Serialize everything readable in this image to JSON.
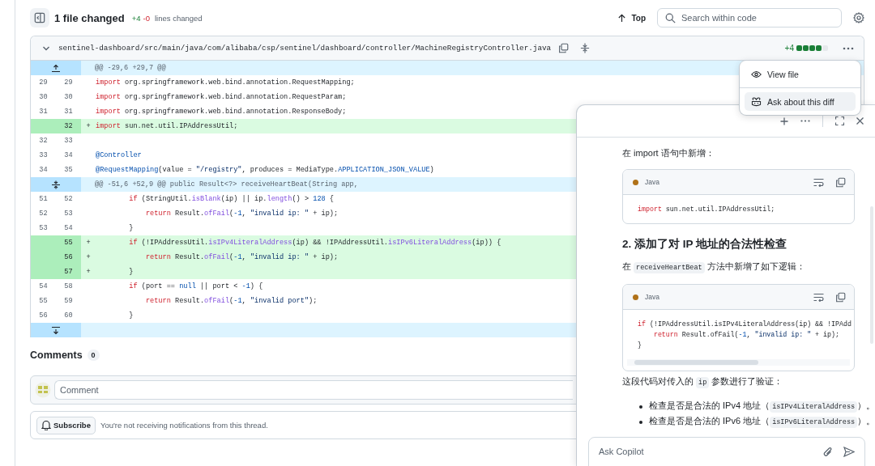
{
  "header": {
    "title": "1 file changed",
    "added": "+4",
    "removed": "-0",
    "note": "lines changed",
    "top_button": "Top",
    "search": {
      "placeholder": "Search within code"
    }
  },
  "file": {
    "path": "sentinel-dashboard/src/main/java/com/alibaba/csp/sentinel/dashboard/controller/MachineRegistryController.java",
    "expanded": true,
    "added": "+4",
    "level": 0.8
  },
  "diff": [
    {
      "kind": "hunk",
      "text": "@@ -29,6 +29,7 @@"
    },
    {
      "kind": "context",
      "old": "29",
      "new": "29",
      "tokens": [
        {
          "text": "import",
          "kind": "keyword"
        },
        {
          "text": " org.springframework.web.bind.annotation.RequestMapping;",
          "kind": "plain"
        }
      ]
    },
    {
      "kind": "context",
      "old": "30",
      "new": "30",
      "tokens": [
        {
          "text": "import",
          "kind": "keyword"
        },
        {
          "text": " org.springframework.web.bind.annotation.RequestParam;",
          "kind": "plain"
        }
      ]
    },
    {
      "kind": "context",
      "old": "31",
      "new": "31",
      "tokens": [
        {
          "text": "import",
          "kind": "keyword"
        },
        {
          "text": " org.springframework.web.bind.annotation.ResponseBody;",
          "kind": "plain"
        }
      ]
    },
    {
      "kind": "addition",
      "new": "32",
      "sign": "+",
      "tokens": [
        {
          "text": "import",
          "kind": "keyword"
        },
        {
          "text": " sun.net.util.IPAddressUtil;",
          "kind": "plain"
        }
      ]
    },
    {
      "kind": "context",
      "old": "32",
      "new": "33"
    },
    {
      "kind": "context",
      "old": "33",
      "new": "34",
      "tokens": [
        {
          "text": "@Controller",
          "kind": "constant"
        }
      ]
    },
    {
      "kind": "context",
      "old": "34",
      "new": "35",
      "tokens": [
        {
          "text": "@RequestMapping",
          "kind": "constant"
        },
        {
          "text": "(value = ",
          "kind": "plain"
        },
        {
          "text": "\"/registry\"",
          "kind": "string"
        },
        {
          "text": ", produces = MediaType.",
          "kind": "plain"
        },
        {
          "text": "APPLICATION_JSON_VALUE",
          "kind": "constant"
        },
        {
          "text": ")",
          "kind": "plain"
        }
      ]
    },
    {
      "kind": "hunk",
      "text": "@@ -51,6 +52,9 @@ public Result<?> receiveHeartBeat(String app,"
    },
    {
      "kind": "context",
      "old": "51",
      "new": "52",
      "tokens": [
        {
          "text": "        if",
          "kind": "keyword"
        },
        {
          "text": " (StringUtil.",
          "kind": "plain"
        },
        {
          "text": "isBlank",
          "kind": "function"
        },
        {
          "text": "(ip) || ip.",
          "kind": "plain"
        },
        {
          "text": "length",
          "kind": "function"
        },
        {
          "text": "() > ",
          "kind": "plain"
        },
        {
          "text": "128",
          "kind": "constant"
        },
        {
          "text": " {",
          "kind": "plain"
        }
      ]
    },
    {
      "kind": "context",
      "old": "52",
      "new": "53",
      "tokens": [
        {
          "text": "            return",
          "kind": "keyword"
        },
        {
          "text": " Result.",
          "kind": "plain"
        },
        {
          "text": "ofFail",
          "kind": "function"
        },
        {
          "text": "(",
          "kind": "plain"
        },
        {
          "text": "-1",
          "kind": "constant"
        },
        {
          "text": ", ",
          "kind": "plain"
        },
        {
          "text": "\"invalid ip: \"",
          "kind": "string"
        },
        {
          "text": " + ip);",
          "kind": "plain"
        }
      ]
    },
    {
      "kind": "context",
      "old": "53",
      "new": "54",
      "tokens": [
        {
          "text": "        }",
          "kind": "plain"
        }
      ]
    },
    {
      "kind": "addition",
      "new": "55",
      "sign": "+",
      "tokens": [
        {
          "text": "        if",
          "kind": "keyword"
        },
        {
          "text": " (!IPAddressUtil.",
          "kind": "plain"
        },
        {
          "text": "isIPv4LiteralAddress",
          "kind": "function"
        },
        {
          "text": "(ip) && !IPAddressUtil.",
          "kind": "plain"
        },
        {
          "text": "isIPv6LiteralAddress",
          "kind": "function"
        },
        {
          "text": "(ip)) {",
          "kind": "plain"
        }
      ]
    },
    {
      "kind": "addition",
      "new": "56",
      "sign": "+",
      "tokens": [
        {
          "text": "            return",
          "kind": "keyword"
        },
        {
          "text": " Result.",
          "kind": "plain"
        },
        {
          "text": "ofFail",
          "kind": "function"
        },
        {
          "text": "(",
          "kind": "plain"
        },
        {
          "text": "-1",
          "kind": "constant"
        },
        {
          "text": ", ",
          "kind": "plain"
        },
        {
          "text": "\"invalid ip: \"",
          "kind": "string"
        },
        {
          "text": " + ip);",
          "kind": "plain"
        }
      ]
    },
    {
      "kind": "addition",
      "new": "57",
      "sign": "+",
      "tokens": [
        {
          "text": "        }",
          "kind": "plain"
        }
      ]
    },
    {
      "kind": "context",
      "old": "54",
      "new": "58",
      "tokens": [
        {
          "text": "        if",
          "kind": "keyword"
        },
        {
          "text": " (port == ",
          "kind": "plain"
        },
        {
          "text": "null",
          "kind": "constant"
        },
        {
          "text": " || port < ",
          "kind": "plain"
        },
        {
          "text": "-1",
          "kind": "constant"
        },
        {
          "text": ") {",
          "kind": "plain"
        }
      ]
    },
    {
      "kind": "context",
      "old": "55",
      "new": "59",
      "tokens": [
        {
          "text": "            return",
          "kind": "keyword"
        },
        {
          "text": " Result.",
          "kind": "plain"
        },
        {
          "text": "ofFail",
          "kind": "function"
        },
        {
          "text": "(",
          "kind": "plain"
        },
        {
          "text": "-1",
          "kind": "constant"
        },
        {
          "text": ", ",
          "kind": "plain"
        },
        {
          "text": "\"invalid port\"",
          "kind": "string"
        },
        {
          "text": ");",
          "kind": "plain"
        }
      ]
    },
    {
      "kind": "context",
      "old": "56",
      "new": "60",
      "tokens": [
        {
          "text": "        }",
          "kind": "plain"
        }
      ]
    },
    {
      "kind": "hunk"
    }
  ],
  "comments": {
    "title": "Comments",
    "count": "0",
    "placeholder": "Comment",
    "subscribe_button": "Subscribe",
    "subscribe_note": "You're not receiving notifications from this thread."
  },
  "menu": [
    {
      "label": "View file",
      "selected": false
    },
    {
      "label": "Ask about this diff",
      "selected": true
    }
  ],
  "copilot": {
    "placeholder": "Ask Copilot",
    "blocks": [
      {
        "kind": "paragraph",
        "parts": [
          {
            "text": "在 import 语句中新增：",
            "kind": "text"
          }
        ]
      },
      {
        "kind": "code",
        "language": "Java",
        "lines": [
          [
            {
              "text": "import",
              "kind": "keyword"
            },
            {
              "text": " sun.net.util.IPAddressUtil;",
              "kind": "plain"
            }
          ]
        ]
      },
      {
        "kind": "heading",
        "text": "2. 添加了对 IP 地址的合法性检查"
      },
      {
        "kind": "paragraph",
        "parts": [
          {
            "text": "在 ",
            "kind": "text"
          },
          {
            "text": "receiveHeartBeat",
            "kind": "code"
          },
          {
            "text": " 方法中新增了如下逻辑：",
            "kind": "text"
          }
        ]
      },
      {
        "kind": "code",
        "language": "Java",
        "scroll": true,
        "lines": [
          [
            {
              "text": "if",
              "kind": "keyword"
            },
            {
              "text": " (!IPAddressUtil.isIPv4LiteralAddress(ip) && !IPAdd",
              "kind": "plain"
            }
          ],
          [
            {
              "text": "    return",
              "kind": "keyword"
            },
            {
              "text": " Result.ofFail(",
              "kind": "plain"
            },
            {
              "text": "-1",
              "kind": "constant"
            },
            {
              "text": ", ",
              "kind": "plain"
            },
            {
              "text": "\"invalid ip: \"",
              "kind": "string"
            },
            {
              "text": " + ip);",
              "kind": "plain"
            }
          ],
          [
            {
              "text": "}",
              "kind": "plain"
            }
          ]
        ]
      },
      {
        "kind": "paragraph",
        "parts": [
          {
            "text": "这段代码对传入的 ",
            "kind": "text"
          },
          {
            "text": "ip",
            "kind": "code"
          },
          {
            "text": " 参数进行了验证：",
            "kind": "text"
          }
        ]
      },
      {
        "kind": "list",
        "items": [
          [
            {
              "text": "检查是否是合法的 IPv4 地址（",
              "kind": "text"
            },
            {
              "text": "isIPv4LiteralAddress",
              "kind": "code"
            },
            {
              "text": "）。",
              "kind": "text"
            }
          ],
          [
            {
              "text": "检查是否是合法的 IPv6 地址（",
              "kind": "text"
            },
            {
              "text": "isIPv6LiteralAddress",
              "kind": "code"
            },
            {
              "text": "）。",
              "kind": "text"
            }
          ]
        ]
      }
    ]
  }
}
